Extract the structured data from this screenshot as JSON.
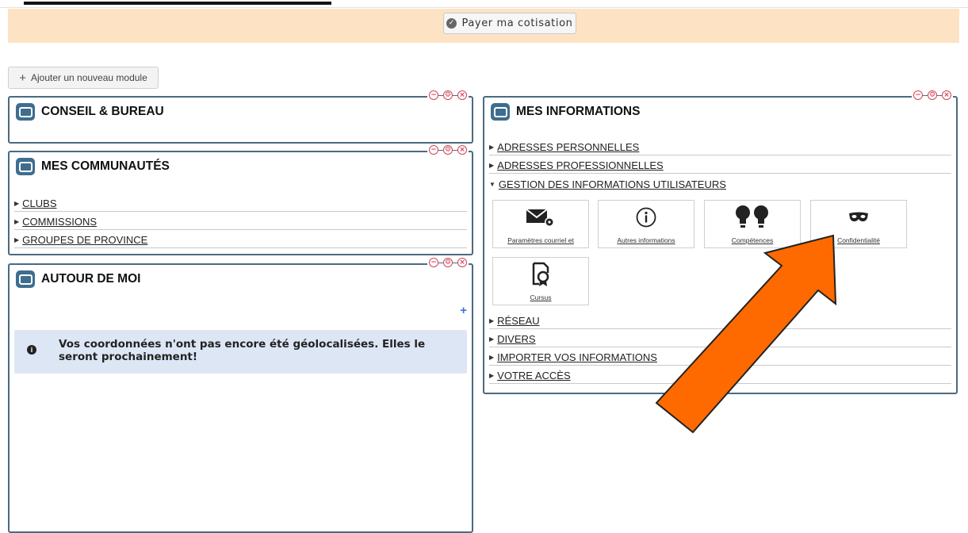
{
  "top_banner": {
    "pay_button": "Payer ma cotisation"
  },
  "toolbar": {
    "add_module": "Ajouter un nouveau module"
  },
  "widget_controls": {
    "minimize": "−",
    "settings": "⚙",
    "close": "×"
  },
  "conseil": {
    "title": "CONSEIL & BUREAU"
  },
  "communautes": {
    "title": "MES COMMUNAUTÉS",
    "items": [
      {
        "label": "CLUBS"
      },
      {
        "label": "COMMISSIONS"
      },
      {
        "label": "GROUPES DE PROVINCE"
      }
    ]
  },
  "autour": {
    "title": "AUTOUR DE MOI",
    "add": "+",
    "alert": "Vos coordonnées n'ont pas encore été géolocalisées. Elles le seront prochainement!"
  },
  "infos": {
    "title": "MES INFORMATIONS",
    "sections_top": [
      {
        "label": "ADRESSES PERSONNELLES"
      },
      {
        "label": "ADRESSES PROFESSIONNELLES"
      }
    ],
    "expanded_section": "GESTION DES INFORMATIONS UTILISATEURS",
    "tiles": [
      {
        "label": "Paramètres courriel et",
        "icon": "mail-settings-icon"
      },
      {
        "label": "Autres informations",
        "icon": "info-circle-icon"
      },
      {
        "label": "Compétences",
        "icon": "lightbulbs-icon"
      },
      {
        "label": "Confidentialité",
        "icon": "mask-icon"
      },
      {
        "label": "Cursus",
        "icon": "certificate-icon"
      }
    ],
    "sections_bottom": [
      {
        "label": "RÉSEAU"
      },
      {
        "label": "DIVERS"
      },
      {
        "label": "IMPORTER VOS INFORMATIONS"
      },
      {
        "label": "VOTRE ACCÈS"
      }
    ]
  },
  "colors": {
    "banner": "#fde3c4",
    "widget_border": "#4b6a80",
    "arrow": "#ff6a00",
    "alert_bg": "#dde6f5"
  }
}
